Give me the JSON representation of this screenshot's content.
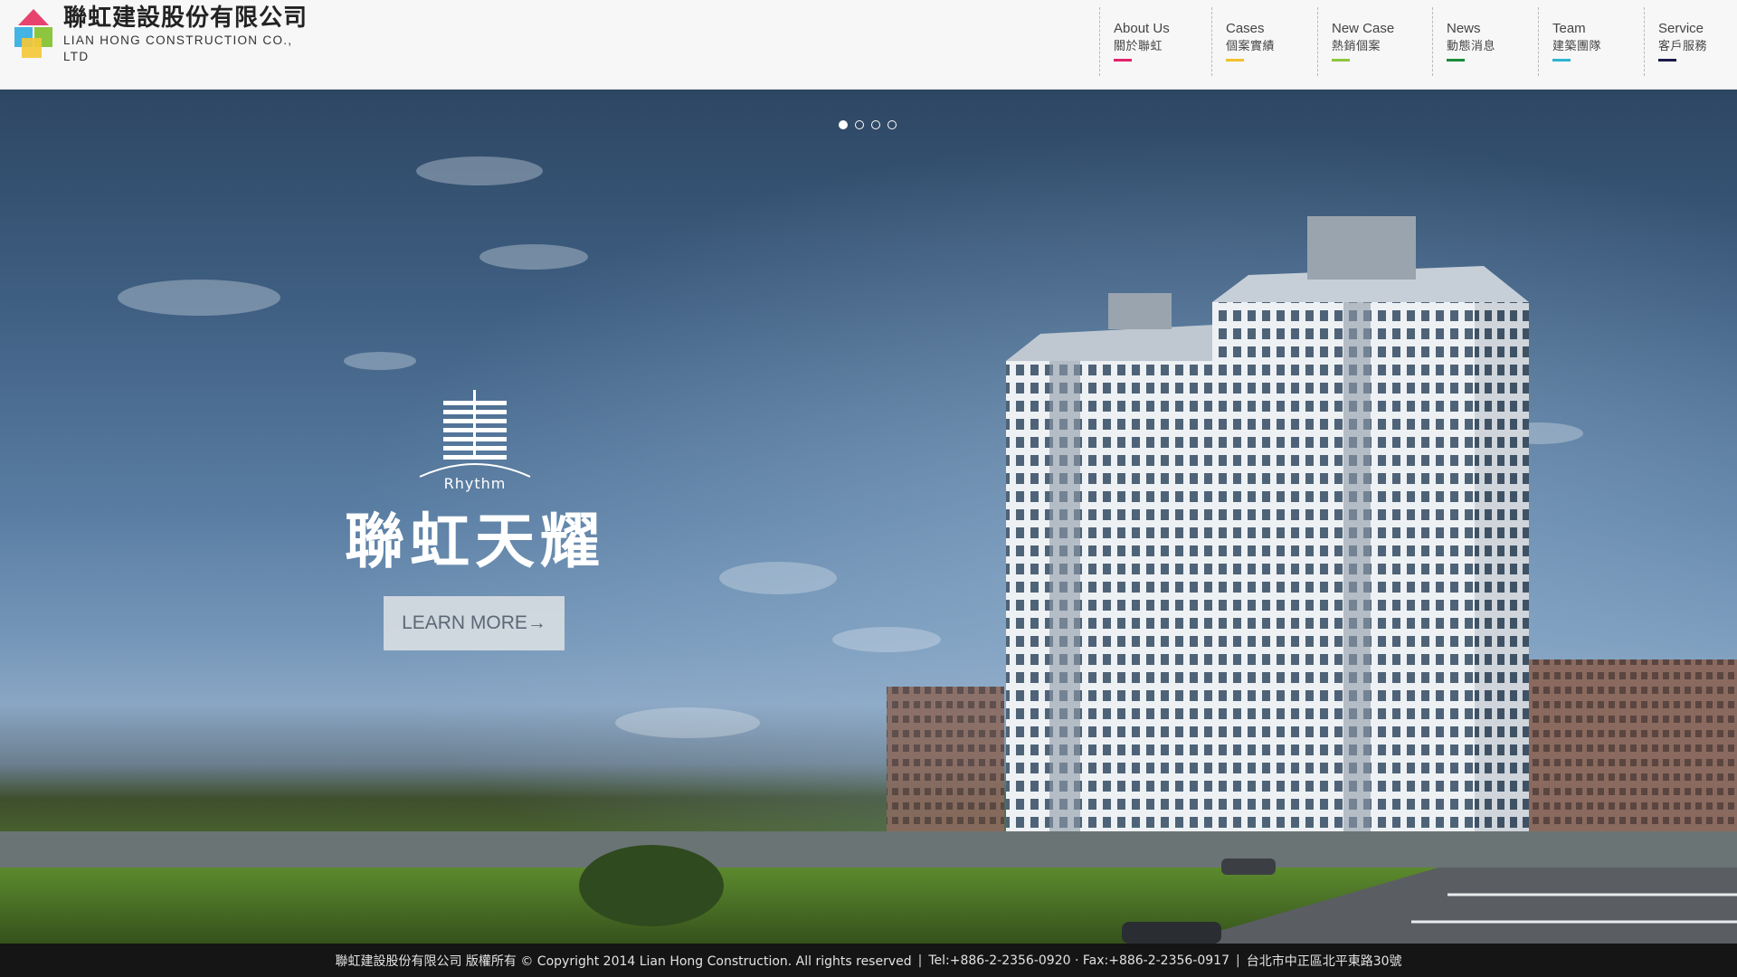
{
  "header": {
    "logo_cn": "聯虹建設股份有限公司",
    "logo_en": "LIAN HONG CONSTRUCTION CO., LTD",
    "logo_colors": [
      "#e8436f",
      "#43b4e4",
      "#f3c838",
      "#8cc63f"
    ]
  },
  "nav": [
    {
      "en": "About Us",
      "cn": "關於聯虹",
      "color": "#e2226b"
    },
    {
      "en": "Cases",
      "cn": "個案實績",
      "color": "#f2c12e"
    },
    {
      "en": "New Case",
      "cn": "熱銷個案",
      "color": "#8cc63f"
    },
    {
      "en": "News",
      "cn": "動態消息",
      "color": "#1b8a3b"
    },
    {
      "en": "Team",
      "cn": "建築團隊",
      "color": "#2bb5d1"
    },
    {
      "en": "Service",
      "cn": "客戶服務",
      "color": "#1a1a4a"
    }
  ],
  "hero": {
    "slides_count": 4,
    "active_slide": 1,
    "brand_sub": "Rhythm",
    "brand_title": "聯虹天耀",
    "button_label": "LEARN MORE→"
  },
  "footer": {
    "copyright": "聯虹建設股份有限公司 版權所有 © Copyright 2014 Lian Hong Construction. All rights reserved",
    "contact": "Tel:+886-2-2356-0920 · Fax:+886-2-2356-0917",
    "address": "台北市中正區北平東路30號",
    "separator": "|"
  }
}
